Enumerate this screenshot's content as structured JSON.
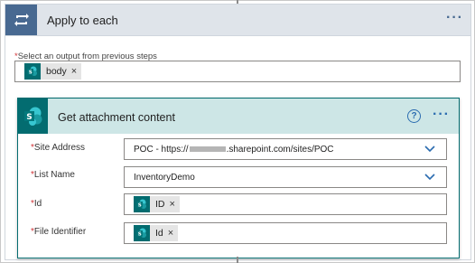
{
  "loop": {
    "title": "Apply to each",
    "more_label": "···",
    "select_label": "Select an output from previous steps",
    "required_mark": "*",
    "token": {
      "label": "body",
      "remove": "×"
    }
  },
  "action": {
    "title": "Get attachment content",
    "help_label": "?",
    "more_label": "···",
    "fields": {
      "site_address": {
        "label": "Site Address",
        "value_prefix": "POC - https://",
        "value_suffix": ".sharepoint.com/sites/POC",
        "required": "*"
      },
      "list_name": {
        "label": "List Name",
        "value": "InventoryDemo",
        "required": "*"
      },
      "id": {
        "label": "Id",
        "token": "ID",
        "remove": "×",
        "required": "*"
      },
      "file_identifier": {
        "label": "File Identifier",
        "token": "Id",
        "remove": "×",
        "required": "*"
      }
    }
  },
  "colors": {
    "loop_accent": "#486991",
    "sharepoint_teal": "#036c70",
    "card_header_bg": "#cde6e6",
    "link_blue": "#2b6cb0",
    "required_red": "#d13438"
  }
}
